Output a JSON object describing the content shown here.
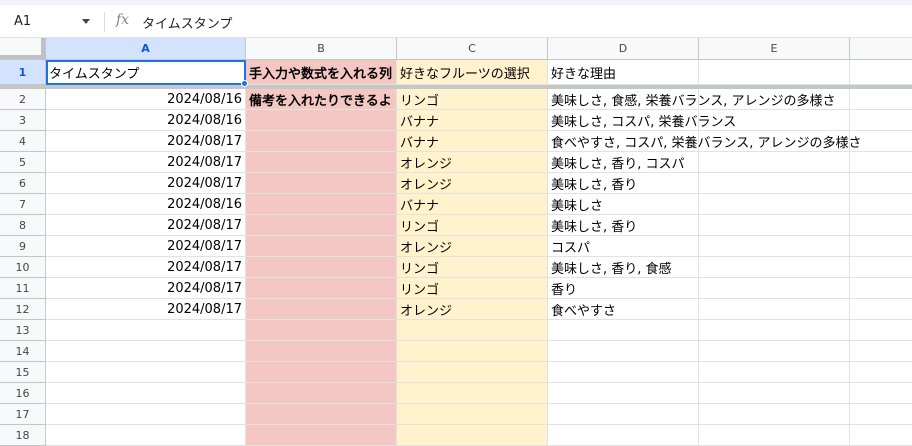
{
  "formula_bar": {
    "name_box": "A1",
    "fx_icon": "fx-icon",
    "content": "タイムスタンプ"
  },
  "columns": [
    "A",
    "B",
    "C",
    "D",
    "E"
  ],
  "rows": [
    "1",
    "2",
    "3",
    "4",
    "5",
    "6",
    "7",
    "8",
    "9",
    "10",
    "11",
    "12",
    "13",
    "14",
    "15",
    "16",
    "17",
    "18"
  ],
  "header_row": {
    "a": "タイムスタンプ",
    "b": "手入力や数式を入れる列",
    "c": "好きなフルーツの選択",
    "d": "好きな理由"
  },
  "data_rows": [
    {
      "a": "2024/08/16",
      "b": "備考を入れたりできるよ",
      "c": "リンゴ",
      "d": "美味しさ, 食感, 栄養バランス, アレンジの多様さ"
    },
    {
      "a": "2024/08/16",
      "b": "",
      "c": "バナナ",
      "d": "美味しさ, コスパ, 栄養バランス"
    },
    {
      "a": "2024/08/17",
      "b": "",
      "c": "バナナ",
      "d": "食べやすさ, コスパ, 栄養バランス, アレンジの多様さ"
    },
    {
      "a": "2024/08/17",
      "b": "",
      "c": "オレンジ",
      "d": "美味しさ, 香り, コスパ"
    },
    {
      "a": "2024/08/17",
      "b": "",
      "c": "オレンジ",
      "d": "美味しさ, 香り"
    },
    {
      "a": "2024/08/16",
      "b": "",
      "c": "バナナ",
      "d": "美味しさ"
    },
    {
      "a": "2024/08/17",
      "b": "",
      "c": "リンゴ",
      "d": "美味しさ, 香り"
    },
    {
      "a": "2024/08/17",
      "b": "",
      "c": "オレンジ",
      "d": "コスパ"
    },
    {
      "a": "2024/08/17",
      "b": "",
      "c": "リンゴ",
      "d": "美味しさ, 香り, 食感"
    },
    {
      "a": "2024/08/17",
      "b": "",
      "c": "リンゴ",
      "d": "香り"
    },
    {
      "a": "2024/08/17",
      "b": "",
      "c": "オレンジ",
      "d": "食べやすさ"
    }
  ],
  "colors": {
    "column_b_fill": "#f4c7c3",
    "column_c_fill": "#fff2cc",
    "selection": "#1a73e8"
  }
}
